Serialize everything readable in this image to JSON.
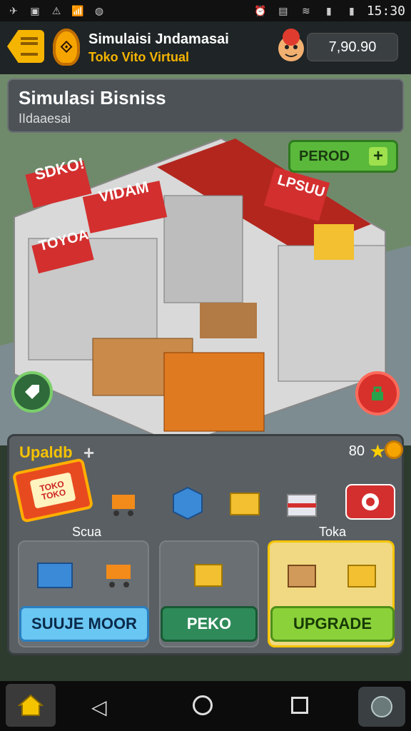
{
  "status_bar": {
    "time": "15:30"
  },
  "header": {
    "title": "Simulaisi Jndamasai",
    "subtitle": "Toko Vito Virtual",
    "coins": "7,90.90"
  },
  "business_card": {
    "title": "Simulasi Bisniss",
    "subtitle": "IIdaaesai"
  },
  "scene": {
    "period_button_label": "PEROD",
    "signs": [
      "SDKO!",
      "VIDAM",
      "TOYOA",
      "LPSUU"
    ]
  },
  "upgrade_panel": {
    "title": "Upaldb",
    "count": "80",
    "item_label_left": "Scua",
    "item_label_right": "Toka",
    "store_badge_text": "TOKO TOKO",
    "buttons": {
      "buy": "SUUJE MOOR",
      "peko": "PEKO",
      "upgrade": "UPGRADE"
    }
  },
  "navbar": {
    "items": [
      "home",
      "back",
      "home",
      "recent",
      "extra"
    ]
  },
  "colors": {
    "accent_yellow": "#f5b400",
    "button_green": "#8bd13a",
    "button_blue": "#6ac6f2",
    "danger_red": "#d8302a"
  }
}
